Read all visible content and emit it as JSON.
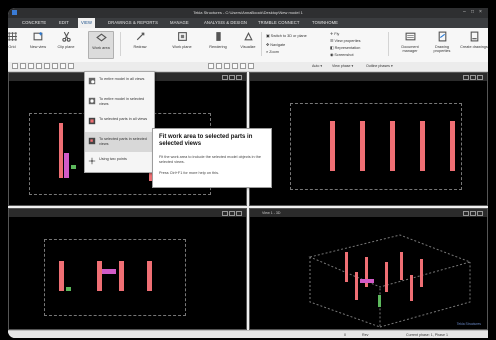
{
  "window": {
    "title": "Tekla Structures - C:\\Users\\AnnaBoock\\Desktop\\New model 1"
  },
  "menu": [
    "CONCRETE",
    "EDIT",
    "VIEW",
    "DRAWINGS & REPORTS",
    "MANAGE",
    "ANALYSIS & DESIGN",
    "TRIMBLE CONNECT",
    "TOWNHOME"
  ],
  "ribbon": {
    "buttons": [
      "Grid",
      "New view",
      "Clip plane",
      "Work area",
      "Redraw",
      "Work plane",
      "Rendering",
      "Visualize"
    ],
    "view_group": [
      "Switch to 3D or plane",
      "Navigate",
      "Zoom"
    ],
    "props_group": [
      "Fly",
      "View properties",
      "Representation",
      "Screenshot"
    ],
    "right_buttons": [
      "Document manager",
      "Drawing properties",
      "Create drawings"
    ]
  },
  "toolbar2": {
    "selection": "Auto",
    "filter": "View phase",
    "filter2": "Outline phases"
  },
  "views": {
    "view1_title": "View 1 - 3D"
  },
  "work_area_menu": {
    "items": [
      "To entire model in all views",
      "To entire model in selected views",
      "To selected parts in all views",
      "To selected parts in selected views",
      "Using two points"
    ],
    "highlighted_index": 3
  },
  "tooltip": {
    "title": "Fit work area to selected parts in selected views",
    "description": "Fit the work area to include the selected model objects in the selected views.",
    "help": "Press Ctrl+F1 for more help on this."
  },
  "status": {
    "left": "0",
    "rev": "Rev",
    "phase": "Current phase: 1, Phase 1"
  },
  "watermark": "Tekla Structures",
  "colors": {
    "column": "#ef6f74",
    "beam": "#d25bc7",
    "accent": "#1a4f8a"
  }
}
